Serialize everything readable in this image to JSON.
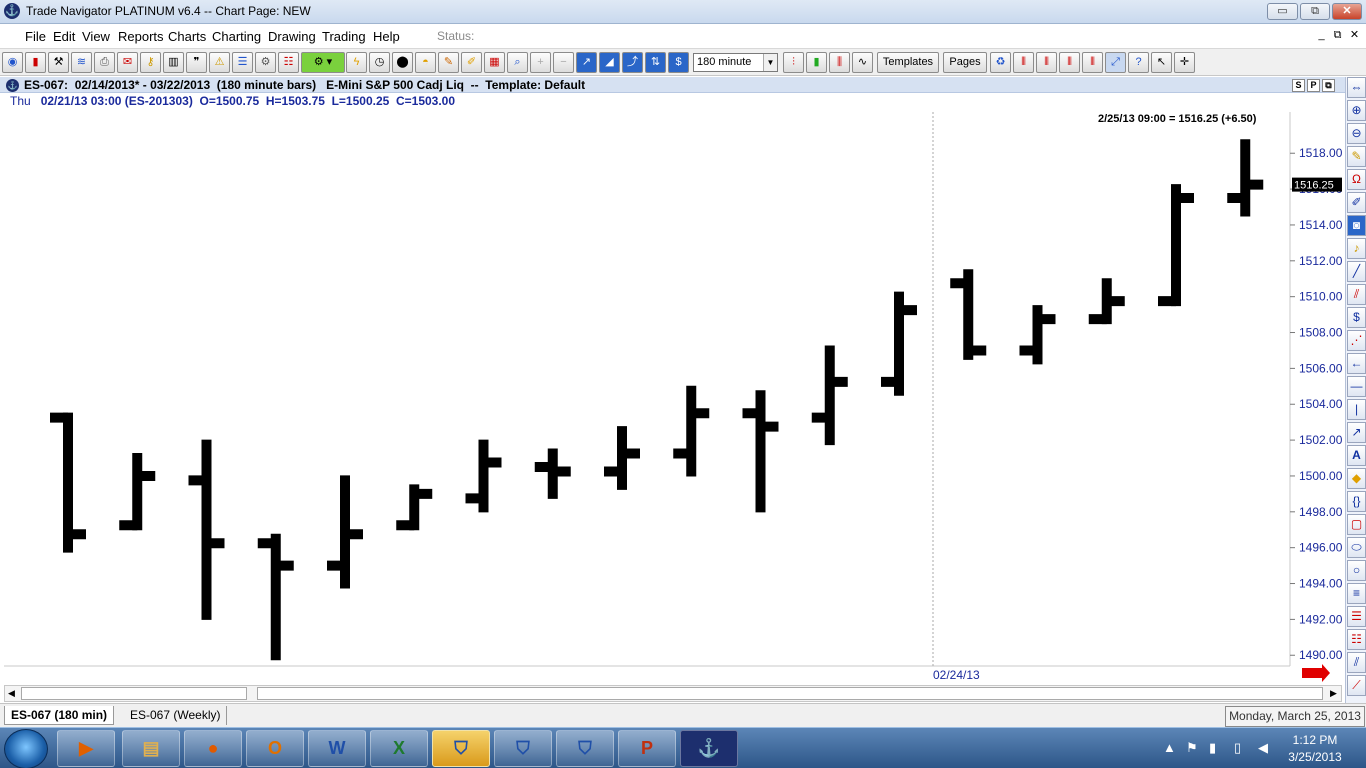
{
  "window": {
    "title": "Trade Navigator PLATINUM v6.4  --  Chart Page: NEW",
    "minimize": "▭",
    "maximize": "⧉",
    "close": "✕"
  },
  "menu": {
    "items": [
      "File",
      "Edit",
      "View",
      "Reports",
      "Charts",
      "Charting",
      "Drawing",
      "Trading",
      "Help"
    ],
    "status_label": "Status:"
  },
  "toolbar": {
    "interval": "180 minute",
    "templates_label": "Templates",
    "pages_label": "Pages"
  },
  "chart_header": {
    "text": "ES-067:  02/14/2013* - 03/22/2013  (180 minute bars)   E-Mini S&P 500 Cadj Liq  --  Template: Default",
    "buttons": [
      "S",
      "P",
      "⧉"
    ]
  },
  "ohlc": {
    "day": "Thu",
    "detail": "02/21/13 03:00 (ES-201303)  O=1500.75  H=1503.75  L=1500.25  C=1503.00"
  },
  "chart_data": {
    "type": "ohlc",
    "annotation": "2/25/13 09:00 = 1516.25 (+6.50)",
    "last_price_label": "1516.25",
    "ylim": [
      1489.4,
      1520.3
    ],
    "yticks": [
      "1490.00",
      "1492.00",
      "1494.00",
      "1496.00",
      "1498.00",
      "1500.00",
      "1502.00",
      "1504.00",
      "1506.00",
      "1508.00",
      "1510.00",
      "1512.00",
      "1514.00",
      "1516.00",
      "1518.00"
    ],
    "x_marker_label": "02/24/13",
    "bars": [
      {
        "o": 1503.25,
        "h": 1503.25,
        "l": 1496.0,
        "c": 1496.75
      },
      {
        "o": 1497.25,
        "h": 1501.0,
        "l": 1497.25,
        "c": 1500.0
      },
      {
        "o": 1499.75,
        "h": 1501.75,
        "l": 1492.25,
        "c": 1496.25
      },
      {
        "o": 1496.25,
        "h": 1496.5,
        "l": 1490.0,
        "c": 1495.0
      },
      {
        "o": 1495.0,
        "h": 1499.75,
        "l": 1494.0,
        "c": 1496.75
      },
      {
        "o": 1497.25,
        "h": 1499.25,
        "l": 1497.25,
        "c": 1499.0
      },
      {
        "o": 1498.75,
        "h": 1501.75,
        "l": 1498.25,
        "c": 1500.75
      },
      {
        "o": 1500.5,
        "h": 1501.25,
        "l": 1499.0,
        "c": 1500.25
      },
      {
        "o": 1500.25,
        "h": 1502.5,
        "l": 1499.5,
        "c": 1501.25
      },
      {
        "o": 1501.25,
        "h": 1504.75,
        "l": 1500.25,
        "c": 1503.5
      },
      {
        "o": 1503.5,
        "h": 1504.5,
        "l": 1498.25,
        "c": 1502.75
      },
      {
        "o": 1503.25,
        "h": 1507.0,
        "l": 1502.0,
        "c": 1505.25
      },
      {
        "o": 1505.25,
        "h": 1510.0,
        "l": 1504.75,
        "c": 1509.25
      },
      {
        "o": 1510.75,
        "h": 1511.25,
        "l": 1506.75,
        "c": 1507.0
      },
      {
        "o": 1507.0,
        "h": 1509.25,
        "l": 1506.5,
        "c": 1508.75
      },
      {
        "o": 1508.75,
        "h": 1510.75,
        "l": 1508.75,
        "c": 1509.75
      },
      {
        "o": 1509.75,
        "h": 1516.0,
        "l": 1509.75,
        "c": 1515.5
      },
      {
        "o": 1515.5,
        "h": 1518.5,
        "l": 1514.75,
        "c": 1516.25
      }
    ]
  },
  "tabs": [
    "ES-067 (180 min)",
    "ES-067 (Weekly)"
  ],
  "tooltip_date": "Monday, March 25, 2013",
  "taskbar": {
    "time": "1:12 PM",
    "date": "3/25/2013"
  },
  "colors": {
    "bar": "#000000",
    "axis_text": "#1a2a9c",
    "header_bg": "#d6e1f2"
  }
}
